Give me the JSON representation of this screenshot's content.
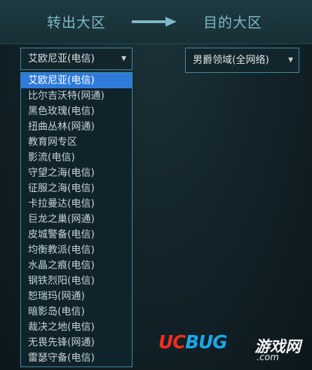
{
  "header": {
    "from_title": "转出大区",
    "to_title": "目的大区"
  },
  "source_select": {
    "value": "艾欧尼亚(电信)",
    "options": [
      "艾欧尼亚(电信)",
      "比尔吉沃特(网通)",
      "黑色玫瑰(电信)",
      "扭曲丛林(网通)",
      "教育网专区",
      "影流(电信)",
      "守望之海(电信)",
      "征服之海(电信)",
      "卡拉曼达(电信)",
      "巨龙之巢(网通)",
      "皮城警备(电信)",
      "均衡教派(电信)",
      "水晶之痕(电信)",
      "钢铁烈阳(电信)",
      "恕瑞玛(网通)",
      "暗影岛(电信)",
      "裁决之地(电信)",
      "无畏先锋(网通)",
      "雷瑟守备(电信)"
    ]
  },
  "target_select": {
    "value": "男爵领域(全网络)"
  },
  "watermark": {
    "uc": "UC",
    "bug": "BUG",
    "cn": "游戏网",
    "com": ".com"
  },
  "colors": {
    "accent": "#3f8ea6",
    "selected": "#2f7bdc",
    "title": "#7fb8c8"
  }
}
